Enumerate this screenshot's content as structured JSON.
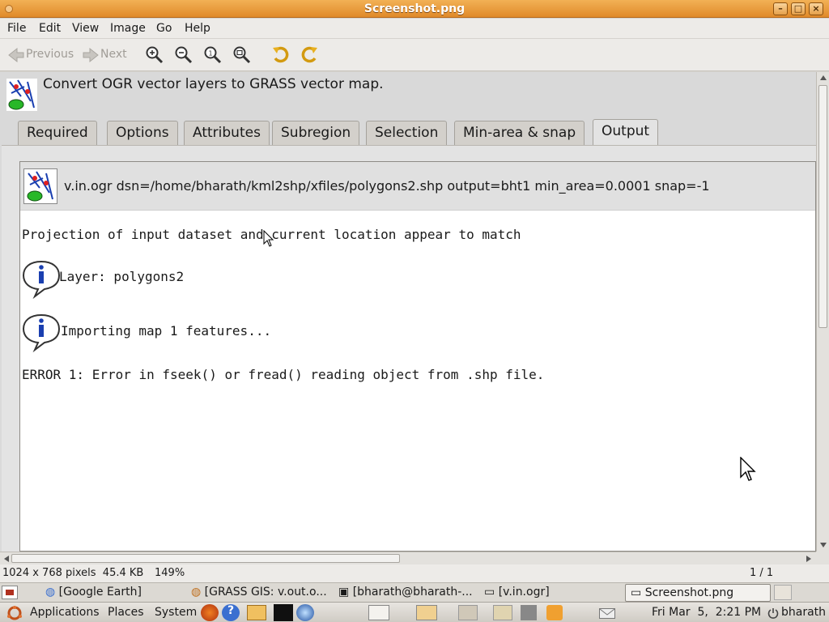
{
  "window": {
    "title": "Screenshot.png"
  },
  "menu": [
    "File",
    "Edit",
    "View",
    "Image",
    "Go",
    "Help"
  ],
  "toolbar": {
    "previous": "Previous",
    "next": "Next"
  },
  "dialog": {
    "description": "Convert OGR vector layers to GRASS vector map.",
    "tabs": [
      "Required",
      "Options",
      "Attributes",
      "Subregion",
      "Selection",
      "Min-area & snap",
      "Output"
    ],
    "active_tab": "Output",
    "command": "v.in.ogr dsn=/home/bharath/kml2shp/xfiles/polygons2.shp output=bht1 min_area=0.0001 snap=-1",
    "output_lines": {
      "projection": "Projection of input dataset and current location appear to match",
      "layer": "Layer: polygons2",
      "importing": "Importing map 1 features...",
      "error": "ERROR 1: Error in fseek() or fread() reading object from .shp file."
    }
  },
  "status": {
    "dimensions": "1024 x 768 pixels  45.4 KB",
    "zoom": "149%",
    "page": "1 / 1"
  },
  "taskbar": [
    "[Google Earth]",
    "[GRASS GIS: v.out.o...",
    "[bharath@bharath-...",
    "[v.in.ogr]",
    "Screenshot.png"
  ],
  "panel": {
    "applications": "Applications",
    "places": "Places",
    "system": "System",
    "datetime": "Fri Mar  5,  2:21 PM",
    "user": "bharath"
  },
  "colors": {
    "titlebar": "#e08a2a",
    "accent": "#f2b155"
  }
}
